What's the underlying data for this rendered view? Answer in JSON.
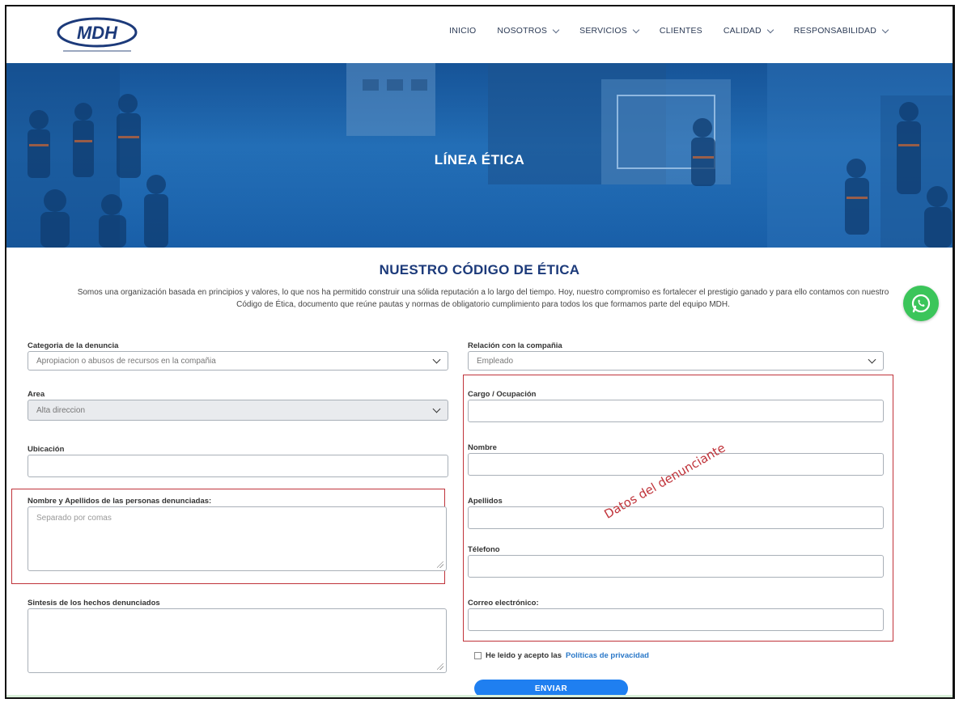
{
  "header": {
    "logo_text": "MDH",
    "nav": [
      {
        "label": "INICIO",
        "dropdown": false
      },
      {
        "label": "NOSOTROS",
        "dropdown": true
      },
      {
        "label": "SERVICIOS",
        "dropdown": true
      },
      {
        "label": "CLIENTES",
        "dropdown": false
      },
      {
        "label": "CALIDAD",
        "dropdown": true
      },
      {
        "label": "RESPONSABILIDAD",
        "dropdown": true
      }
    ]
  },
  "hero": {
    "title": "LÍNEA ÉTICA"
  },
  "section": {
    "title": "NUESTRO CÓDIGO DE ÉTICA",
    "intro": "Somos una organización basada en principios y valores, lo que nos ha permitido construir una sólida reputación a lo largo del tiempo. Hoy, nuestro compromiso es fortalecer el prestigio ganado y para ello contamos con nuestro Código de Ética, documento que reúne pautas y normas de obligatorio cumplimiento para todos los que formamos parte del equipo MDH."
  },
  "form": {
    "categoria": {
      "label": "Categoria de la denuncia",
      "value": "Apropiacion o abusos de recursos en la compañia"
    },
    "area": {
      "label": "Area",
      "value": "Alta direccion"
    },
    "ubicacion": {
      "label": "Ubicación",
      "value": ""
    },
    "denunciados": {
      "label": "Nombre y Apellidos de las personas denunciadas:",
      "placeholder": "Separado por comas"
    },
    "sintesis": {
      "label": "Sintesis de los hechos denunciados",
      "value": ""
    },
    "relacion": {
      "label": "Relación con la compañia",
      "value": "Empleado"
    },
    "cargo": {
      "label": "Cargo / Ocupación",
      "value": ""
    },
    "nombre": {
      "label": "Nombre",
      "value": ""
    },
    "apellidos": {
      "label": "Apellidos",
      "value": ""
    },
    "telefono": {
      "label": "Télefono",
      "value": ""
    },
    "correo": {
      "label": "Correo electrónico:",
      "value": ""
    },
    "privacy_prefix": "He leido y acepto las",
    "privacy_link": "Políticas de privacidad",
    "submit": "ENVIAR"
  },
  "annotation": {
    "text": "Datos del denunciante",
    "color": "#c0333a"
  },
  "colors": {
    "brand": "#1c3a7a",
    "accent": "#1f7ff0",
    "whatsapp": "#3bc55a"
  }
}
